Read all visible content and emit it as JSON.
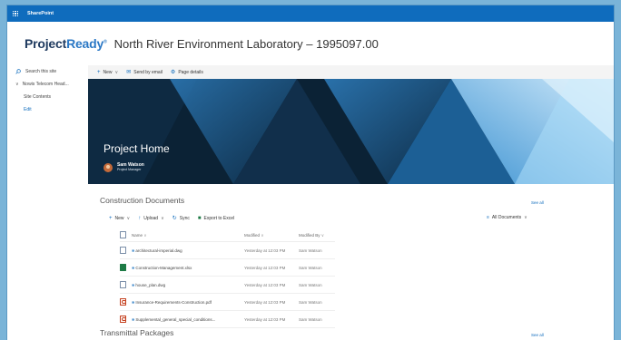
{
  "suite": {
    "title": "SharePoint"
  },
  "site": {
    "logo_main": "Project",
    "logo_accent": "Ready",
    "logo_mark": "®",
    "title": "North River Environment Laboratory – 1995097.00"
  },
  "leftnav": {
    "search_placeholder": "Search this site",
    "items": [
      {
        "label": "Nowis Telecom Head..."
      },
      {
        "label": "Site Contents"
      }
    ],
    "edit_label": "Edit"
  },
  "commandbar": {
    "new_label": "New",
    "email_label": "Send by email",
    "details_label": "Page details"
  },
  "hero": {
    "title": "Project Home",
    "person_name": "Sam Watson",
    "person_role": "Project Manager"
  },
  "documents": {
    "title": "Construction Documents",
    "see_all": "See all",
    "commands": {
      "new_label": "New",
      "upload_label": "Upload",
      "sync_label": "Sync",
      "export_label": "Export to Excel"
    },
    "view_label": "All Documents",
    "columns": {
      "name": "Name",
      "modified": "Modified",
      "modified_by": "Modified By"
    },
    "rows": [
      {
        "name": "architectural-imperial.dwg",
        "type": "dwg",
        "modified": "Yesterday at 12:03 PM",
        "modified_by": "Sam Watson"
      },
      {
        "name": "Construction-Management.xlsx",
        "type": "xlsx",
        "modified": "Yesterday at 12:03 PM",
        "modified_by": "Sam Watson"
      },
      {
        "name": "house_plan.dwg",
        "type": "dwg",
        "modified": "Yesterday at 12:03 PM",
        "modified_by": "Sam Watson"
      },
      {
        "name": "Insurance-Requirements-Construction.pdf",
        "type": "pdf",
        "modified": "Yesterday at 12:03 PM",
        "modified_by": "Sam Watson"
      },
      {
        "name": "Supplemental_general_special_conditions...",
        "type": "pdf",
        "modified": "Yesterday at 12:03 PM",
        "modified_by": "Sam Watson"
      }
    ]
  },
  "transmittals": {
    "title": "Transmittal Packages",
    "see_all": "See all"
  },
  "colors": {
    "brand": "#0f6cbd",
    "hero_dark": "#0b2235",
    "hero_light": "#7fc4ee",
    "page_bg": "#7ab4d8"
  }
}
